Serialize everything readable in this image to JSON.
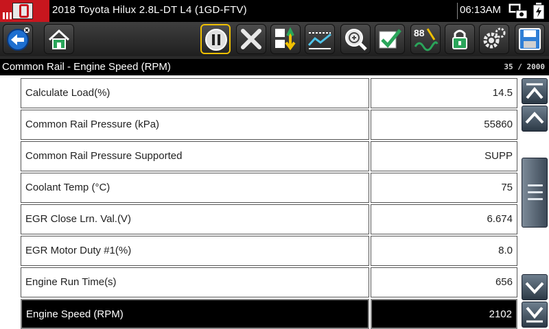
{
  "app": {
    "title": "2018 Toyota Hilux 2.8L-DT L4 (1GD-FTV)",
    "clock": "06:13AM"
  },
  "toolbar": {
    "buttons": [
      {
        "name": "back",
        "icon": "back-arrow-icon"
      },
      {
        "name": "home",
        "icon": "home-icon"
      },
      {
        "name": "pause",
        "icon": "pause-icon"
      },
      {
        "name": "exit",
        "icon": "close-icon"
      },
      {
        "name": "sort",
        "icon": "sort-icon"
      },
      {
        "name": "graph",
        "icon": "graph-icon"
      },
      {
        "name": "zoom",
        "icon": "zoom-icon"
      },
      {
        "name": "select",
        "icon": "checkmark-icon"
      },
      {
        "name": "units",
        "icon": "units-icon",
        "label": "88"
      },
      {
        "name": "lock",
        "icon": "lock-icon"
      },
      {
        "name": "settings",
        "icon": "gear-icon"
      },
      {
        "name": "save",
        "icon": "save-icon"
      }
    ]
  },
  "header": {
    "title": "Common Rail - Engine Speed (RPM)",
    "count": "35 / 2000"
  },
  "pids": [
    {
      "name": "Calculate Load(%)",
      "value": "14.5"
    },
    {
      "name": "Common Rail Pressure (kPa)",
      "value": "55860"
    },
    {
      "name": "Common Rail Pressure Supported",
      "value": "SUPP"
    },
    {
      "name": "Coolant Temp (°C)",
      "value": "75"
    },
    {
      "name": "EGR Close Lrn. Val.(V)",
      "value": "6.674"
    },
    {
      "name": "EGR Motor Duty #1(%)",
      "value": "8.0"
    },
    {
      "name": "Engine Run Time(s)",
      "value": "656"
    },
    {
      "name": "Engine Speed (RPM)",
      "value": "2102",
      "selected": true
    }
  ],
  "colors": {
    "brand_red": "#c8161e",
    "active_border": "#f0c000",
    "selected_row_bg": "#000000"
  }
}
